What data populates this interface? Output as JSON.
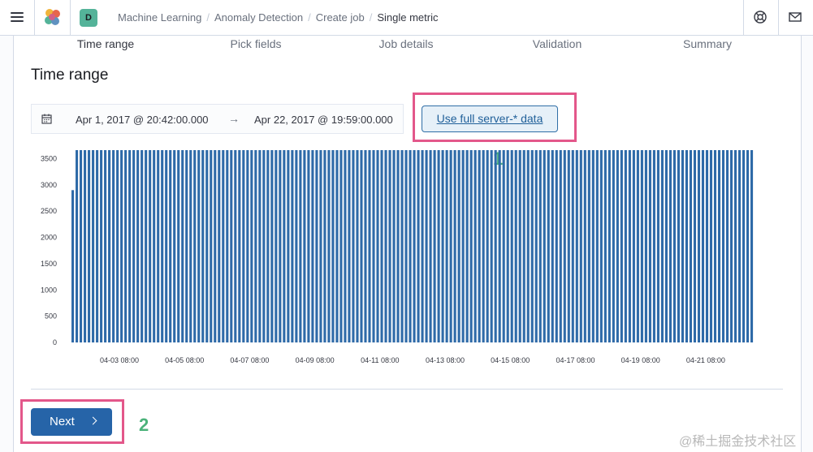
{
  "header": {
    "space_initial": "D",
    "breadcrumbs": [
      "Machine Learning",
      "Anomaly Detection",
      "Create job",
      "Single metric"
    ],
    "icons": [
      "menu-icon",
      "kibana-logo",
      "help-icon",
      "mail-icon"
    ]
  },
  "steps": [
    "Time range",
    "Pick fields",
    "Job details",
    "Validation",
    "Summary"
  ],
  "section_title": "Time range",
  "date_picker": {
    "start": "Apr 1, 2017 @ 20:42:00.000",
    "arrow": "→",
    "end": "Apr 22, 2017 @ 19:59:00.000"
  },
  "full_data_button": "Use full server-* data",
  "annotations": [
    "1",
    "2"
  ],
  "next_button": "Next",
  "watermark": "@稀土掘金技术社区",
  "colors": {
    "accent": "#2664a8",
    "bar": "#2e6aa8",
    "highlight": "#e3578a",
    "annotation": "#4bb27a"
  },
  "chart_data": {
    "type": "bar",
    "title": "",
    "xlabel": "",
    "ylabel": "",
    "ylim": [
      0,
      3600
    ],
    "yticks": [
      0,
      500,
      1000,
      1500,
      2000,
      2500,
      3000,
      3500
    ],
    "xticks": [
      "04-03 08:00",
      "04-05 08:00",
      "04-07 08:00",
      "04-09 08:00",
      "04-11 08:00",
      "04-13 08:00",
      "04-15 08:00",
      "04-17 08:00",
      "04-19 08:00",
      "04-21 08:00"
    ],
    "x_start": "2017-04-01 20:42",
    "x_end": "2017-04-22 19:59",
    "bin_hours": 3,
    "first_value": 2900,
    "typical_value": 3770,
    "bar_count": 168
  }
}
